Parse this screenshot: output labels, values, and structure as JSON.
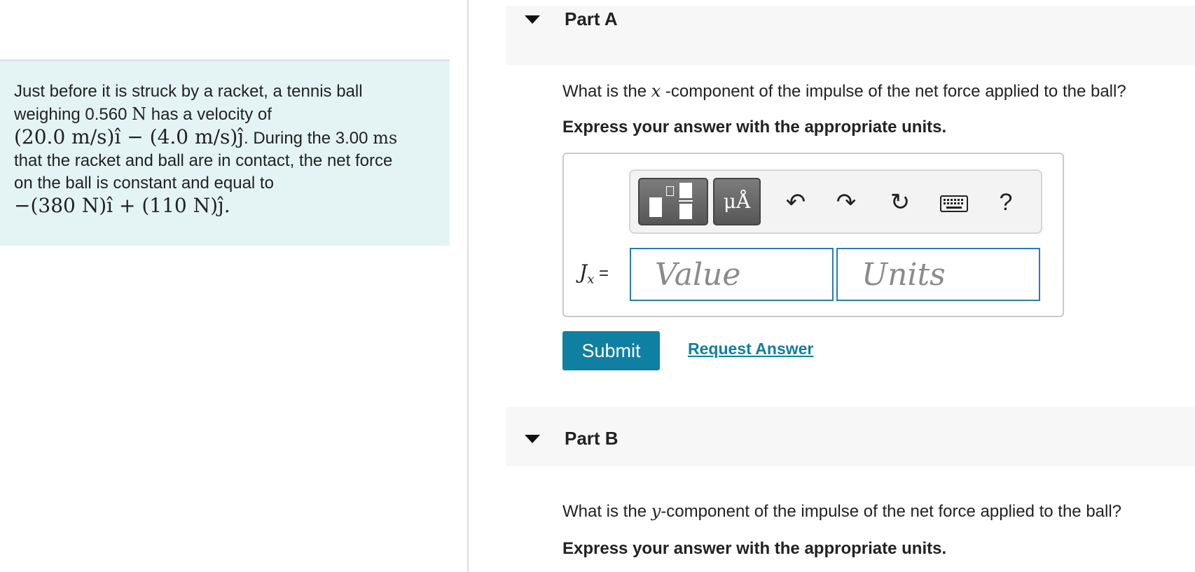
{
  "problem": {
    "line1": "Just before it is struck by a racket, a tennis ball",
    "line2_a": "weighing 0.560 ",
    "line2_unit": "N",
    "line2_b": " has a velocity of",
    "line3_math": "(20.0 m/s)î − (4.0 m/s)ĵ",
    "line3_text": ". During the 3.00 ",
    "line3_unit": "ms",
    "line4": "that the racket and ball are in contact, the net force",
    "line5": "on the ball is constant and equal to",
    "line6_math": "−(380 N)î + (110 N)ĵ."
  },
  "part_a": {
    "title": "Part A",
    "question_before": "What is the ",
    "question_var": "x",
    "question_after": " -component of the impulse of the net force applied to the ball?",
    "instruction": "Express your answer with the appropriate units.",
    "toolbar": {
      "units_label": "μÅ",
      "undo_icon": "↶",
      "redo_icon": "↷",
      "reset_icon": "↻",
      "help_label": "?"
    },
    "answer_var": "J",
    "answer_sub": "x",
    "answer_eq": " =",
    "value_placeholder": "Value",
    "units_placeholder": "Units",
    "submit_label": "Submit",
    "request_label": "Request Answer"
  },
  "part_b": {
    "title": "Part B",
    "question_before": "What is the ",
    "question_var": "y",
    "question_after": "-component of the impulse of the net force applied to the ball?",
    "instruction": "Express your answer with the appropriate units."
  }
}
